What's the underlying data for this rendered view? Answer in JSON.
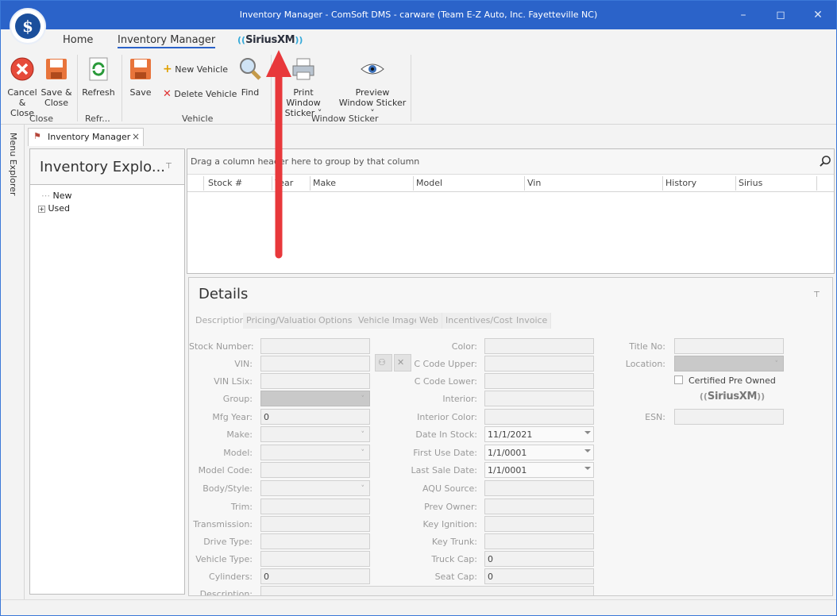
{
  "window": {
    "title": "Inventory Manager - ComSoft DMS - carware (Team E-Z Auto, Inc. Fayetteville NC)",
    "logo_symbol": "$"
  },
  "ribbon_tabs": {
    "home": "Home",
    "inventory_manager": "Inventory Manager",
    "siriusxm": "SiriusXM",
    "siriusxm_waves_left": "((",
    "siriusxm_waves_right": "))"
  },
  "ribbon": {
    "cancel_close": "Cancel & Close",
    "save_close": "Save & Close",
    "refresh": "Refresh",
    "save": "Save",
    "new_vehicle": "New Vehicle",
    "delete_vehicle": "Delete Vehicle",
    "find": "Find",
    "print_window_sticker": "Print Window Sticker",
    "preview_window_sticker": "Preview Window Sticker",
    "groups": {
      "close": "Close",
      "refresh": "Refr...",
      "vehicle": "Vehicle",
      "window_sticker": "Window Sticker"
    }
  },
  "sidebar": {
    "menu_explorer": "Menu Explorer"
  },
  "doc_tab": {
    "label": "Inventory Manager",
    "close": "×"
  },
  "explorer": {
    "title": "Inventory Explo...",
    "nodes": {
      "new": "New",
      "used": "Used"
    },
    "expand": "+"
  },
  "grid": {
    "group_hint": "Drag a column header here to group by that column",
    "columns": {
      "stock": "Stock #",
      "year": "Year",
      "make": "Make",
      "model": "Model",
      "vin": "Vin",
      "history": "History",
      "sirius": "Sirius"
    }
  },
  "details": {
    "title": "Details",
    "tabs": {
      "description": "Description",
      "pricing": "Pricing/Valuation",
      "options": "Options",
      "vehicle_image": "Vehicle Image",
      "web": "Web",
      "incentives": "Incentives/Cost",
      "invoice": "Invoice"
    },
    "labels": {
      "stock_number": "Stock Number:",
      "vin": "VIN:",
      "vin_lsix": "VIN LSix:",
      "group": "Group:",
      "mfg_year": "Mfg Year:",
      "make": "Make:",
      "model": "Model:",
      "model_code": "Model Code:",
      "body_style": "Body/Style:",
      "trim": "Trim:",
      "transmission": "Transmission:",
      "drive_type": "Drive Type:",
      "vehicle_type": "Vehicle Type:",
      "cylinders": "Cylinders:",
      "description": "Description:",
      "color": "Color:",
      "c_code_upper": "C Code Upper:",
      "c_code_lower": "C Code Lower:",
      "interior": "Interior:",
      "interior_color": "Interior Color:",
      "date_in_stock": "Date In Stock:",
      "first_use_date": "First Use Date:",
      "last_sale_date": "Last Sale Date:",
      "aqu_source": "AQU Source:",
      "prev_owner": "Prev Owner:",
      "key_ignition": "Key Ignition:",
      "key_trunk": "Key Trunk:",
      "truck_cap": "Truck Cap:",
      "seat_cap": "Seat Cap:",
      "title_no": "Title No:",
      "location": "Location:",
      "certified": "Certified Pre Owned",
      "esn": "ESN:",
      "siriusxm": "SiriusXM"
    },
    "values": {
      "mfg_year": "0",
      "cylinders": "0",
      "date_in_stock": "11/1/2021",
      "first_use_date": "1/1/0001",
      "last_sale_date": "1/1/0001",
      "truck_cap": "0",
      "seat_cap": "0"
    }
  },
  "colors": {
    "titlebar": "#2b63c9",
    "accent_arrow": "#e8383b"
  }
}
